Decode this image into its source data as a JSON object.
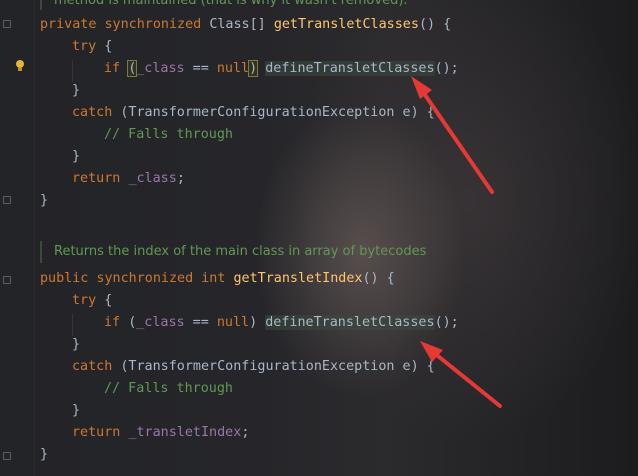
{
  "doc_top": "method is maintained (that is why it wasn't removed).",
  "method1": {
    "sig_kw": "private synchronized ",
    "sig_type": "Class[] ",
    "sig_name": "getTransletClasses",
    "sig_rest": "() {",
    "try_kw": "try",
    "try_brace": " {",
    "if_kw": "if",
    "cond_open": "(",
    "cond_field": "_class",
    "cond_eq": " == ",
    "cond_null": "null",
    "cond_close": ")",
    "call": "defineTransletClasses",
    "call_end": "();",
    "close_try": "}",
    "catch_kw": "catch",
    "catch_rest": " (TransformerConfigurationException e) {",
    "comment": "// Falls through",
    "close_catch": "}",
    "return_kw": "return",
    "return_field": "_class",
    "return_end": ";",
    "close_method": "}"
  },
  "doc_block": "Returns the index of the main class in array of bytecodes",
  "method2": {
    "sig_kw": "public synchronized int ",
    "sig_name": "getTransletIndex",
    "sig_rest": "() {",
    "try_kw": "try",
    "try_brace": " {",
    "if_kw": "if",
    "cond_open": "(",
    "cond_field": "_class",
    "cond_eq": " == ",
    "cond_null": "null",
    "cond_close": ")",
    "call": "defineTransletClasses",
    "call_end": "();",
    "close_try": "}",
    "catch_kw": "catch",
    "catch_rest": " (TransformerConfigurationException e) {",
    "comment": "// Falls through",
    "close_catch": "}",
    "return_kw": "return",
    "return_field": "_transletIndex",
    "return_end": ";",
    "close_method": "}"
  },
  "icons": [
    "intention-bulb-icon",
    "annotation-arrow-icon"
  ],
  "colors": {
    "keyword": "#cc7832",
    "function": "#ffc66d",
    "field": "#9876aa",
    "comment": "#629755",
    "text": "#a9b7c6",
    "arrow": "#e53935"
  }
}
